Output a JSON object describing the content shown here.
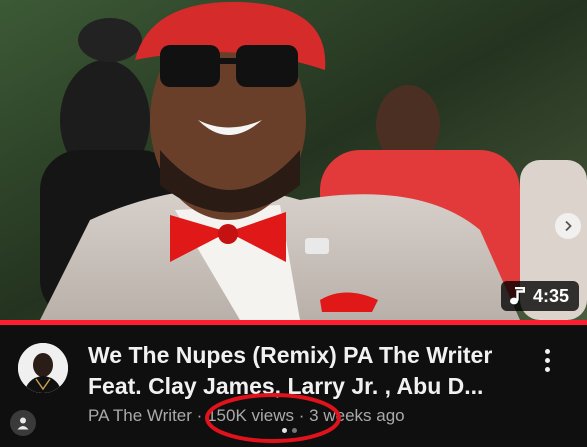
{
  "video": {
    "duration": "4:35",
    "title": "We The Nupes (Remix) PA The Writer\nFeat. Clay James, Larry Jr. , Abu D...",
    "channel": "PA The Writer",
    "separator": "·",
    "views": "150K views",
    "age": "3 weeks ago",
    "progress_fraction": 1.0
  },
  "icons": {
    "duration_icon": "music-note-icon",
    "next": "chevron-right-icon",
    "more": "more-vert-icon",
    "account": "person-icon"
  },
  "carousel": {
    "pages": 2,
    "active_index": 0
  },
  "colors": {
    "progress": "#ff1d2f",
    "background": "#0f0f0f",
    "annotation_circle": "#e0121c"
  }
}
